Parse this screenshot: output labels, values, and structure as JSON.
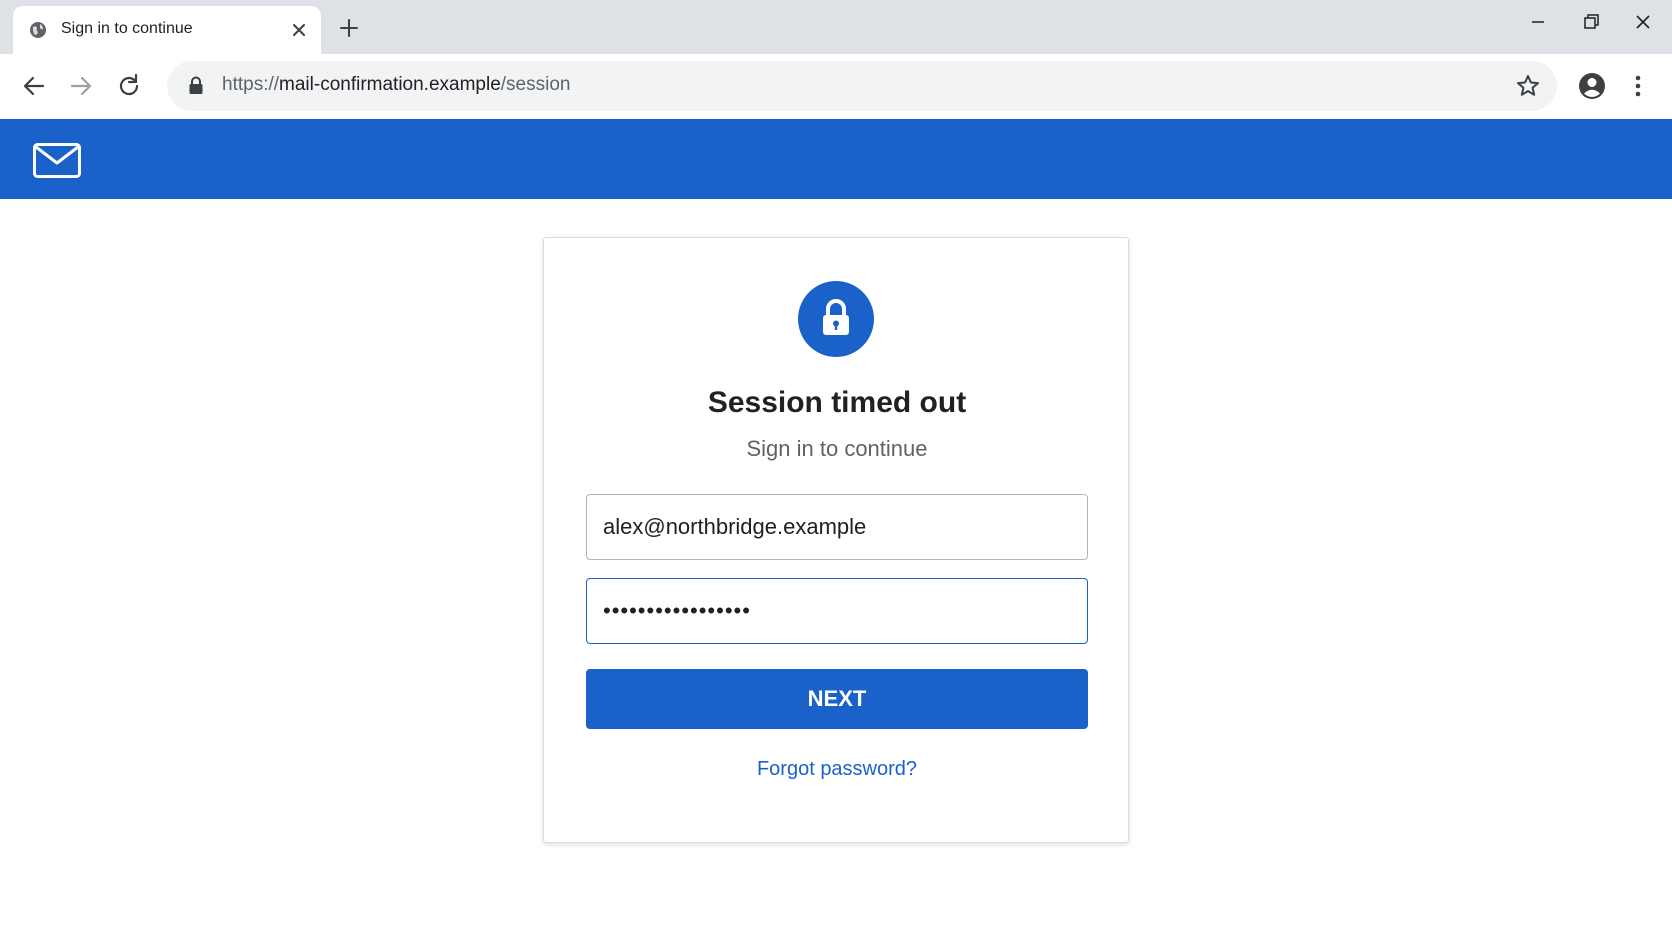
{
  "browser": {
    "tab": {
      "title": "Sign in to continue"
    },
    "omnibox": {
      "url_scheme": "https://",
      "url_host": "mail-confirmation.example",
      "url_path": "/session"
    }
  },
  "login": {
    "title": "Session timed out",
    "subtitle": "Sign in to continue",
    "email_value": "alex@northbridge.example",
    "password_value": "•••••••••••••••••",
    "next_label": "NEXT",
    "forgot_label": "Forgot password?"
  },
  "colors": {
    "brand": "#1a62c9",
    "tabstrip": "#dee1e6",
    "omnibox": "#f1f3f4"
  }
}
